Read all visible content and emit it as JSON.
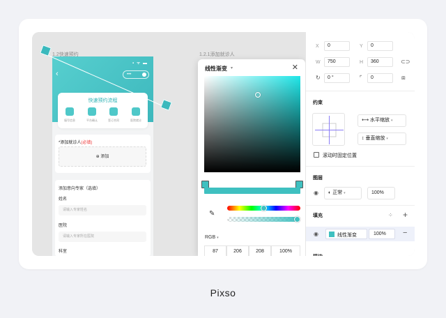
{
  "canvas": {
    "frame1_label": "1.2快速预约",
    "frame2_label": "1.2.1添加就诊人"
  },
  "phone": {
    "back": "‹",
    "status": "▪ ᯤ ▬",
    "pill_text": "•••",
    "flow_title": "快速预约流程",
    "steps": [
      "填写信息",
      "平台确认",
      "签订合同",
      "医院就诊"
    ],
    "patient_label": "*添加就诊人",
    "required_text": "(必填)",
    "add_button": "⊕ 添加",
    "expert_title": "添加意向专家（选填）",
    "name_label": "姓名",
    "name_placeholder": "请输入专家姓名",
    "hospital_label": "医院",
    "hospital_placeholder": "请输入专家所在医院",
    "dept_label": "科室"
  },
  "picker": {
    "title": "线性渐变",
    "caret": "▾",
    "close": "✕",
    "mode": "RGB",
    "mode_caret": "▾",
    "values": [
      "87",
      "206",
      "208",
      "100%"
    ],
    "hue_fraction": 0.5,
    "alpha_fraction": 1.0
  },
  "panel": {
    "x_label": "X",
    "x_value": "0",
    "y_label": "Y",
    "y_value": "0",
    "w_label": "W",
    "w_value": "750",
    "h_label": "H",
    "h_value": "360",
    "rotation_value": "0 °",
    "radius_value": "0",
    "constraints_title": "约束",
    "h_scale": "水平缩放",
    "v_scale": "垂直缩放",
    "fixed_scroll": "滚动时固定位置",
    "layer_title": "图层",
    "blend": "正常",
    "layer_opacity": "100%",
    "fill_title": "填充",
    "fill_name": "线性渐变",
    "fill_opacity": "100%",
    "stroke_title": "描边"
  },
  "footer": {
    "brand": "Pixso"
  },
  "colors": {
    "accent": "#3fc0c0",
    "brand_teal": "#57cfcf"
  }
}
